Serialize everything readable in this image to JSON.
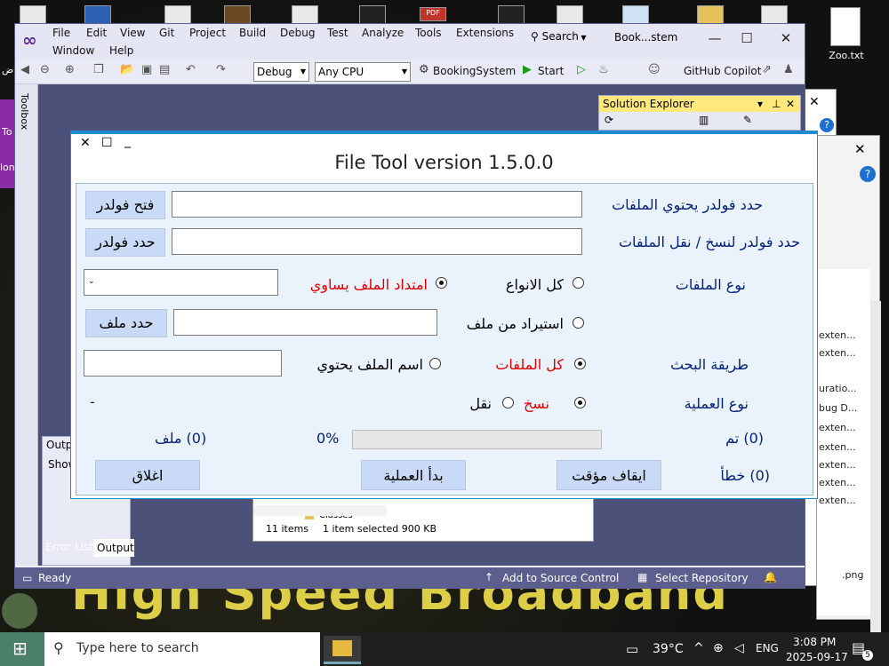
{
  "desktop": {
    "icon_label": "Zoo.txt",
    "pdf_label": "PDF",
    "banner_text": "High Speed Broadband",
    "side_label_1": "To",
    "side_label_2": "lon",
    "side_label_3": "ض"
  },
  "vs": {
    "menu": [
      "File",
      "Edit",
      "View",
      "Git",
      "Project",
      "Build",
      "Debug",
      "Test",
      "Analyze",
      "Tools",
      "Extensions",
      "Window",
      "Help"
    ],
    "search_label": "Search",
    "title": "Book...stem",
    "config": "Debug",
    "platform": "Any CPU",
    "startup_project": "BookingSystem",
    "start_label": "Start",
    "copilot_label": "GitHub Copilot",
    "toolbox_label": "Toolbox",
    "solution_explorer_title": "Solution Explorer",
    "output_title": "Outp",
    "show_label": "Show",
    "tab_error_list": "Error List",
    "tab_output": "Output",
    "status_ready": "Ready",
    "status_source_control": "Add to Source Control",
    "status_repository": "Select Repository"
  },
  "explorer": {
    "folder_label": "Classes",
    "item_count": "11 items",
    "selection": "1 item selected  900 KB"
  },
  "right_window": {
    "items": [
      "exten...",
      "exten...",
      "uratio...",
      "bug D...",
      "exten...",
      "exten...",
      "exten...",
      "exten...",
      "exten..."
    ],
    "png_label": ".png"
  },
  "filetool": {
    "title": "File Tool version 1.5.0.0",
    "src_folder_label": "حدد فولدر يحتوي الملفات",
    "open_folder_btn": "فتح فولدر",
    "dest_folder_label": "حدد فولدر لنسخ / نقل الملفات",
    "select_folder_btn": "حدد فولدر",
    "file_type_label": "نوع الملفات",
    "all_types_option": "كل الانواع",
    "ext_equals_option": "امتداد الملف يساوي",
    "import_file_option": "استيراد من ملف",
    "select_file_btn": "حدد ملف",
    "search_method_label": "طريقة البحث",
    "all_files_option": "كل الملفات",
    "name_contains_option": "اسم الملف يحتوي",
    "operation_label": "نوع العملية",
    "copy_option": "نسخ",
    "move_option": "نقل",
    "dash_text": "-",
    "done_count": "(0) تم",
    "percent": "0%",
    "file_count": "(0) ملف",
    "error_count": "(0) خطأ",
    "pause_btn": "ايقاف مؤقت",
    "start_btn": "بدأ العملية",
    "close_btn": "اغلاق",
    "progress_value": 0
  },
  "taskbar": {
    "search_placeholder": "Type here to search",
    "temperature": "39°C",
    "language": "ENG",
    "time": "3:08 PM",
    "date": "2025-09-17",
    "notification_count": "5"
  }
}
